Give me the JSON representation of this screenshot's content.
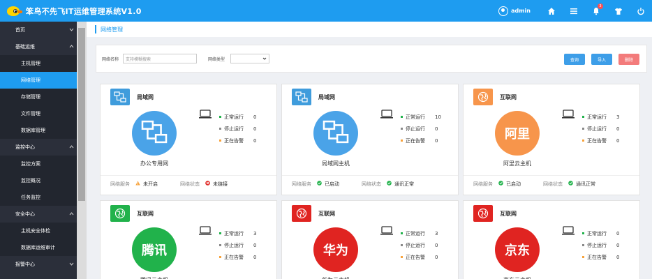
{
  "app": {
    "title": "笨鸟不先飞IT运维管理系统V1.0",
    "user": "admin",
    "notification_count": "3"
  },
  "colors": {
    "primary": "#1e9cf0",
    "sidebar": "#2b2f3a",
    "green": "#21b24b",
    "orange": "#f7954b",
    "red": "#e02421",
    "danger_button": "#f37b7b"
  },
  "sidebar": {
    "items": [
      {
        "label": "首页",
        "kind": "group",
        "chevron": "down"
      },
      {
        "label": "基础运维",
        "kind": "group",
        "chevron": "up"
      },
      {
        "label": "主机管理",
        "kind": "child"
      },
      {
        "label": "网络管理",
        "kind": "child",
        "active": true
      },
      {
        "label": "存储管理",
        "kind": "child"
      },
      {
        "label": "文件管理",
        "kind": "child"
      },
      {
        "label": "数据库管理",
        "kind": "child"
      },
      {
        "label": "监控中心",
        "kind": "group",
        "chevron": "up"
      },
      {
        "label": "监控方案",
        "kind": "child"
      },
      {
        "label": "监控概况",
        "kind": "child"
      },
      {
        "label": "任务监控",
        "kind": "child"
      },
      {
        "label": "安全中心",
        "kind": "group",
        "chevron": "up"
      },
      {
        "label": "主机安全体检",
        "kind": "child"
      },
      {
        "label": "数据库运维审计",
        "kind": "child"
      },
      {
        "label": "报警中心",
        "kind": "group",
        "chevron": "down"
      }
    ]
  },
  "breadcrumb": "网络管理",
  "filter": {
    "name_label": "网络名称",
    "name_placeholder": "支持模糊搜索",
    "type_label": "网络类型",
    "type_value": "",
    "query_button": "查询",
    "import_button": "导入",
    "delete_button": "删除"
  },
  "cards": [
    {
      "type": "局域网",
      "type_icon": "lan-icon",
      "icon_color": "#3f9cdc",
      "circle_color": "#4aa3e8",
      "circle_text": "",
      "circle_icon": "lan-icon",
      "name": "办公专用网",
      "stats": [
        {
          "label": "正常运行",
          "value": "0"
        },
        {
          "label": "停止运行",
          "value": "0"
        },
        {
          "label": "正在告警",
          "value": "0"
        }
      ],
      "service_label": "网络服务",
      "service_value": "未开启",
      "service_icon": "warning-icon",
      "status_label": "网络状态",
      "status_value": "未链接",
      "status_icon": "error-icon"
    },
    {
      "type": "局域网",
      "type_icon": "lan-icon",
      "icon_color": "#3f9cdc",
      "circle_color": "#4aa3e8",
      "circle_text": "",
      "circle_icon": "lan-icon",
      "name": "局域网主机",
      "stats": [
        {
          "label": "正常运行",
          "value": "10"
        },
        {
          "label": "停止运行",
          "value": "0"
        },
        {
          "label": "正在告警",
          "value": "0"
        }
      ],
      "service_label": "网络服务",
      "service_value": "已启动",
      "service_icon": "check-icon",
      "status_label": "网络状态",
      "status_value": "通讯正常",
      "status_icon": "check-icon"
    },
    {
      "type": "互联网",
      "type_icon": "globe-icon",
      "icon_color": "#f7954b",
      "circle_color": "#f7954b",
      "circle_text": "阿里",
      "circle_icon": "",
      "name": "阿里云主机",
      "stats": [
        {
          "label": "正常运行",
          "value": "3"
        },
        {
          "label": "停止运行",
          "value": "0"
        },
        {
          "label": "正在告警",
          "value": "0"
        }
      ],
      "service_label": "网络服务",
      "service_value": "已启动",
      "service_icon": "check-icon",
      "status_label": "网络状态",
      "status_value": "通讯正常",
      "status_icon": "check-icon"
    },
    {
      "type": "互联网",
      "type_icon": "globe-icon",
      "icon_color": "#21b24b",
      "circle_color": "#21b24b",
      "circle_text": "腾讯",
      "circle_icon": "",
      "name": "腾讯云主机",
      "stats": [
        {
          "label": "正常运行",
          "value": "3"
        },
        {
          "label": "停止运行",
          "value": "0"
        },
        {
          "label": "正在告警",
          "value": "0"
        }
      ],
      "service_label": "",
      "service_value": "",
      "service_icon": "",
      "status_label": "",
      "status_value": "",
      "status_icon": ""
    },
    {
      "type": "互联网",
      "type_icon": "globe-icon",
      "icon_color": "#e02421",
      "circle_color": "#e02421",
      "circle_text": "华为",
      "circle_icon": "",
      "name": "华为云主机",
      "stats": [
        {
          "label": "正常运行",
          "value": "3"
        },
        {
          "label": "停止运行",
          "value": "0"
        },
        {
          "label": "正在告警",
          "value": "0"
        }
      ],
      "service_label": "",
      "service_value": "",
      "service_icon": "",
      "status_label": "",
      "status_value": "",
      "status_icon": ""
    },
    {
      "type": "互联网",
      "type_icon": "globe-icon",
      "icon_color": "#e02421",
      "circle_color": "#e02421",
      "circle_text": "京东",
      "circle_icon": "",
      "name": "京东云主机",
      "stats": [
        {
          "label": "正常运行",
          "value": "0"
        },
        {
          "label": "停止运行",
          "value": "0"
        },
        {
          "label": "正在告警",
          "value": "0"
        }
      ],
      "service_label": "",
      "service_value": "",
      "service_icon": "",
      "status_label": "",
      "status_value": "",
      "status_icon": ""
    }
  ]
}
